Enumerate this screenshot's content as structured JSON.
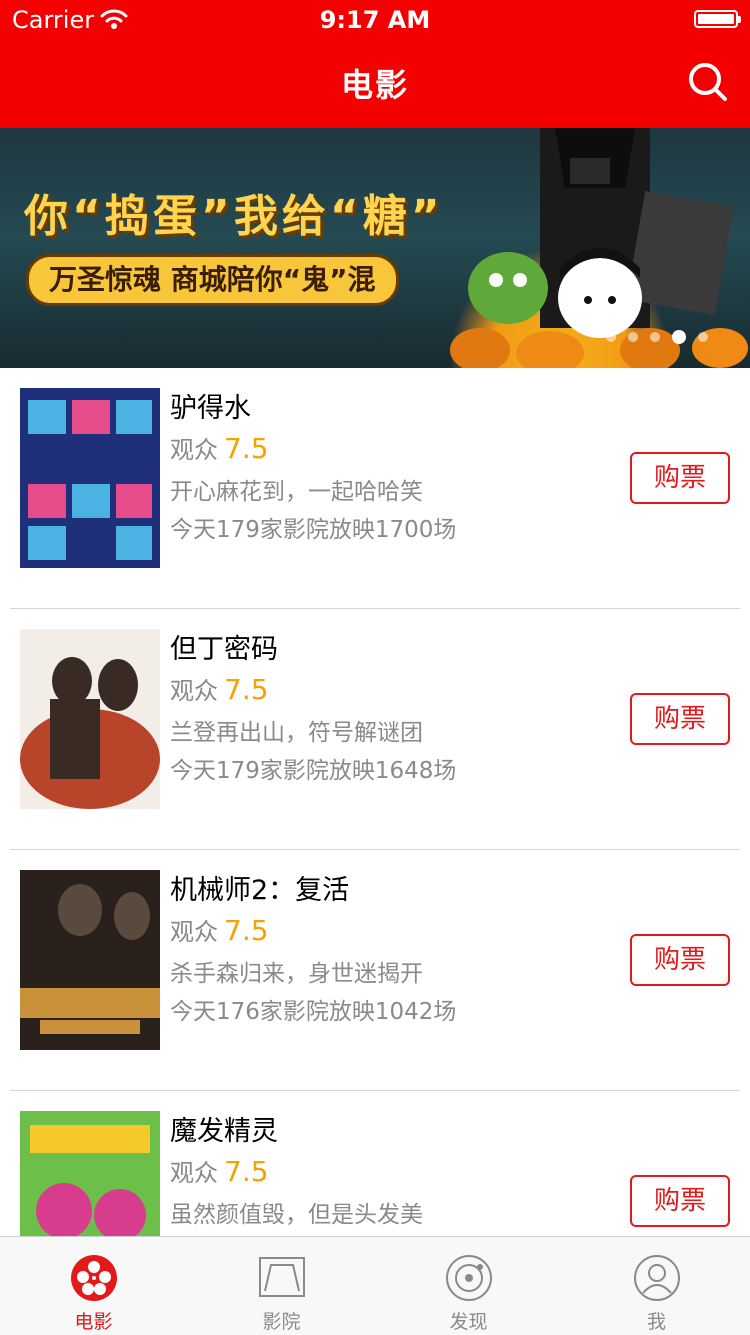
{
  "status_bar": {
    "carrier": "Carrier",
    "time": "9:17 AM",
    "battery_level": 1.0
  },
  "nav": {
    "title": "电影",
    "search_icon": "search-icon"
  },
  "banner": {
    "slogan": "你“捣蛋”我给“糖”",
    "subtitle": "万圣惊魂 商城陪你“鬼”混",
    "page_count": 5,
    "active_page": 3
  },
  "movies": [
    {
      "title": "驴得水",
      "score_label": "观众",
      "score": "7.5",
      "desc": "开心麻花到，一起哈哈笑",
      "showing": "今天179家影院放映1700场",
      "buy_label": "购票",
      "poster_colors": [
        "#1f2f7a",
        "#4bb3e3",
        "#e64c8a"
      ]
    },
    {
      "title": "但丁密码",
      "score_label": "观众",
      "score": "7.5",
      "desc": "兰登再出山，符号解谜团",
      "showing": "今天179家影院放映1648场",
      "buy_label": "购票",
      "poster_colors": [
        "#f2ede6",
        "#b8442a",
        "#3a2a24"
      ]
    },
    {
      "title": "机械师2：复活",
      "score_label": "观众",
      "score": "7.5",
      "desc": "杀手森归来，身世迷揭开",
      "showing": "今天176家影院放映1042场",
      "buy_label": "购票",
      "poster_colors": [
        "#2a211c",
        "#c9913a",
        "#5a4a3e"
      ]
    },
    {
      "title": "魔发精灵",
      "score_label": "观众",
      "score": "7.5",
      "desc": "虽然颜值毁，但是头发美",
      "showing": "",
      "buy_label": "购票",
      "poster_colors": [
        "#6cc04a",
        "#d83c8c",
        "#f6c92b"
      ]
    }
  ],
  "tabbar": {
    "active": 0,
    "tabs": [
      {
        "label": "电影",
        "icon": "film-reel-icon"
      },
      {
        "label": "影院",
        "icon": "cinema-screen-icon"
      },
      {
        "label": "发现",
        "icon": "discover-icon"
      },
      {
        "label": "我",
        "icon": "profile-icon"
      }
    ]
  },
  "colors": {
    "brand_red": "#f40000",
    "score_orange": "#f5a300",
    "button_red": "#e21a1a",
    "text_gray": "#8a8a8a"
  }
}
